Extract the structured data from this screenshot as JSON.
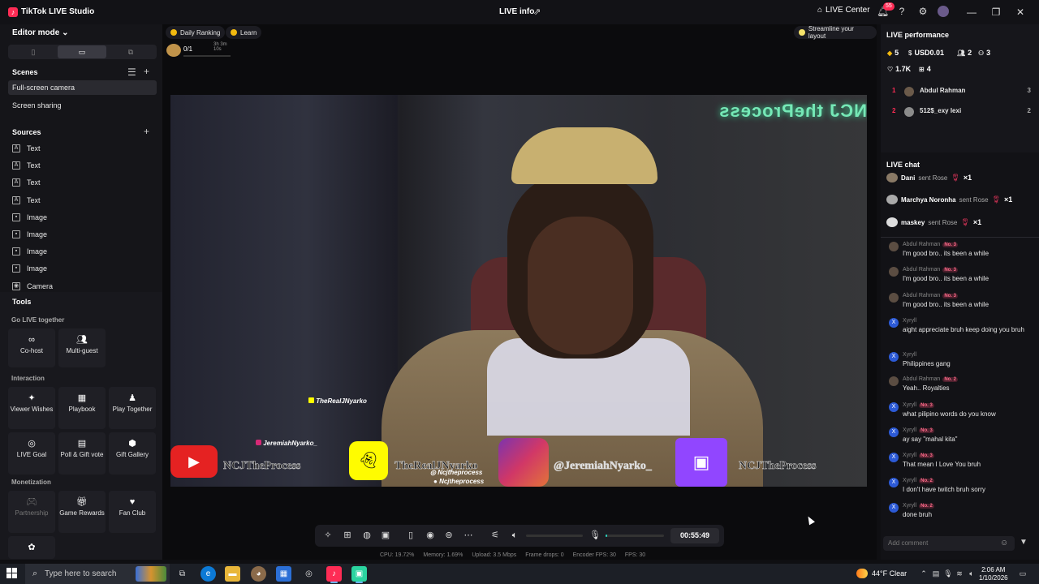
{
  "app": {
    "title": "TikTok LIVE Studio",
    "logo_glyph": "♪",
    "center_title": "LIVE info",
    "live_center_label": "LIVE Center",
    "notification_count": "55"
  },
  "sidebar": {
    "editor_mode_label": "Editor mode",
    "scenes_header": "Scenes",
    "scenes": [
      "Full-screen camera",
      "Screen sharing"
    ],
    "sources_header": "Sources",
    "sources": [
      {
        "label": "Text",
        "icon": "text-icon"
      },
      {
        "label": "Text",
        "icon": "text-icon"
      },
      {
        "label": "Text",
        "icon": "text-icon"
      },
      {
        "label": "Text",
        "icon": "text-icon"
      },
      {
        "label": "Image",
        "icon": "image-icon"
      },
      {
        "label": "Image",
        "icon": "image-icon"
      },
      {
        "label": "Image",
        "icon": "image-icon"
      },
      {
        "label": "Image",
        "icon": "image-icon"
      },
      {
        "label": "Camera",
        "icon": "camera-icon"
      }
    ],
    "tools_header": "Tools",
    "go_live_together_header": "Go LIVE together",
    "interaction_header": "Interaction",
    "monetization_header": "Monetization",
    "tools": {
      "cohost": "Co-host",
      "multiguest": "Multi-guest",
      "viewer_wishes": "Viewer Wishes",
      "playbook": "Playbook",
      "play_together": "Play Together",
      "live_goal": "LIVE Goal",
      "poll_gift_vote": "Poll & Gift vote",
      "gift_gallery": "Gift Gallery",
      "partnership": "Partnership",
      "game_rewards": "Game Rewards",
      "fan_club": "Fan Club"
    }
  },
  "center": {
    "daily_ranking": "Daily Ranking",
    "learn": "Learn",
    "streamline": "Streamline your layout",
    "rank_count": "0/1",
    "rank_timer": "3h 3m 10s",
    "overlay_handle_top": "TheRealJNyarko",
    "overlay_handle_left": "JeremiahNyarko_",
    "social_texts": {
      "youtube": "NCJTheProcess",
      "snapchat": "TheRealJNyarko",
      "instagram": "@JeremiahNyarko_",
      "twitch": "NCJTheProcess"
    },
    "overlay_handle_small1": "Ncjtheprocess",
    "overlay_handle_small2": "Ncjtheprocess",
    "neon_sign": "NCJ theProcess",
    "timer": "00:55:49",
    "mic_level": 0.03,
    "stats": {
      "cpu": "CPU: 19.72%",
      "memory": "Memory: 1.69%",
      "upload": "Upload: 3.5 Mbps",
      "frame_drops": "Frame drops: 0",
      "encoder_fps": "Encoder FPS: 30",
      "fps": "FPS: 30"
    }
  },
  "performance": {
    "title": "LIVE performance",
    "diamonds": "5",
    "usd": "USD0.01",
    "viewers": "2",
    "new_followers": "3",
    "likes": "1.7K",
    "gifters": "4",
    "top_gifters": [
      {
        "rank": "1",
        "name": "Abdul Rahman",
        "score": "3"
      },
      {
        "rank": "2",
        "name": "512$_exy lexi",
        "score": "2"
      }
    ]
  },
  "chat": {
    "title": "LIVE chat",
    "gifts": [
      {
        "user": "Dani",
        "action": "sent Rose",
        "count": "×1"
      },
      {
        "user": "Marchya Noronha",
        "action": "sent Rose",
        "count": "×1"
      },
      {
        "user": "maskey",
        "action": "sent Rose",
        "count": "×1"
      }
    ],
    "messages": [
      {
        "user": "Abdul Rahman",
        "badge": "No. 3",
        "text": "I'm good bro.. its been a while",
        "avatar": "photo"
      },
      {
        "user": "Abdul Rahman",
        "badge": "No. 3",
        "text": "I'm good bro.. its been a while",
        "avatar": "photo"
      },
      {
        "user": "Abdul Rahman",
        "badge": "No. 3",
        "text": "I'm good bro.. its been a while",
        "avatar": "photo"
      },
      {
        "user": "Xyryll",
        "badge": "",
        "text": "aight appreciate bruh keep doing you bruh",
        "avatar": "X"
      },
      {
        "user": "Xyryll",
        "badge": "",
        "text": "Philippines gang",
        "avatar": "X"
      },
      {
        "user": "Abdul Rahman",
        "badge": "No. 2",
        "text": "Yeah.. Royalties",
        "avatar": "photo"
      },
      {
        "user": "Xyryll",
        "badge": "No. 3",
        "text": "what pilipino words do you know",
        "avatar": "X"
      },
      {
        "user": "Xyryll",
        "badge": "No. 3",
        "text": "ay say \"mahal kita\"",
        "avatar": "X"
      },
      {
        "user": "Xyryll",
        "badge": "No. 3",
        "text": "That mean I Love You bruh",
        "avatar": "X"
      },
      {
        "user": "Xyryll",
        "badge": "No. 2",
        "text": "I don't have twitch bruh sorry",
        "avatar": "X"
      },
      {
        "user": "Xyryll",
        "badge": "No. 2",
        "text": "done bruh",
        "avatar": "X"
      }
    ],
    "comment_placeholder": "Add comment"
  },
  "taskbar": {
    "search_placeholder": "Type here to search",
    "weather": "44°F  Clear",
    "time": "2:06 AM",
    "date": "1/10/2026"
  },
  "colors": {
    "brand": "#fe2c55",
    "accent_teal": "#2bd4c0",
    "twitch": "#9146ff",
    "youtube": "#e52222",
    "snapchat": "#fffc00"
  }
}
